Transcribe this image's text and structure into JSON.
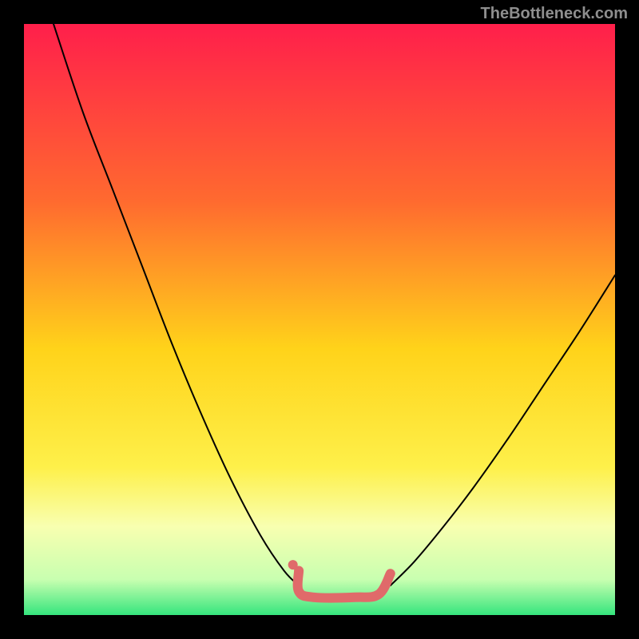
{
  "watermark": "TheBottleneck.com",
  "chart_data": {
    "type": "line",
    "title": "",
    "xlabel": "",
    "ylabel": "",
    "xlim": [
      0,
      100
    ],
    "ylim": [
      0,
      100
    ],
    "background_gradient": {
      "stops": [
        {
          "offset": 0,
          "color": "#ff1f4b"
        },
        {
          "offset": 30,
          "color": "#ff6a2f"
        },
        {
          "offset": 55,
          "color": "#ffd31a"
        },
        {
          "offset": 75,
          "color": "#fef04a"
        },
        {
          "offset": 85,
          "color": "#f8ffb0"
        },
        {
          "offset": 94,
          "color": "#c8ffb0"
        },
        {
          "offset": 100,
          "color": "#35e57d"
        }
      ]
    },
    "series": [
      {
        "name": "left-curve",
        "stroke": "#000000",
        "points": [
          {
            "x": 5,
            "y": 100
          },
          {
            "x": 10,
            "y": 85
          },
          {
            "x": 15,
            "y": 72
          },
          {
            "x": 20,
            "y": 59
          },
          {
            "x": 25,
            "y": 46
          },
          {
            "x": 30,
            "y": 34
          },
          {
            "x": 35,
            "y": 23
          },
          {
            "x": 40,
            "y": 13.5
          },
          {
            "x": 44,
            "y": 7.5
          },
          {
            "x": 46.5,
            "y": 5
          }
        ]
      },
      {
        "name": "right-curve",
        "stroke": "#000000",
        "points": [
          {
            "x": 62,
            "y": 5
          },
          {
            "x": 66,
            "y": 9
          },
          {
            "x": 71,
            "y": 15
          },
          {
            "x": 76,
            "y": 21.5
          },
          {
            "x": 82,
            "y": 30
          },
          {
            "x": 88,
            "y": 39
          },
          {
            "x": 94,
            "y": 48
          },
          {
            "x": 100,
            "y": 57.5
          }
        ]
      },
      {
        "name": "bottom-bracket",
        "stroke": "#e06a6a",
        "stroke_width": 12,
        "points": [
          {
            "x": 46.5,
            "y": 7.5
          },
          {
            "x": 46.5,
            "y": 4
          },
          {
            "x": 49,
            "y": 3
          },
          {
            "x": 56,
            "y": 3
          },
          {
            "x": 60,
            "y": 3.5
          },
          {
            "x": 62,
            "y": 7
          }
        ]
      },
      {
        "name": "bottom-dot",
        "type": "scatter",
        "marker_color": "#e06a6a",
        "marker_radius": 6,
        "points": [
          {
            "x": 45.5,
            "y": 8.5
          }
        ]
      }
    ]
  }
}
